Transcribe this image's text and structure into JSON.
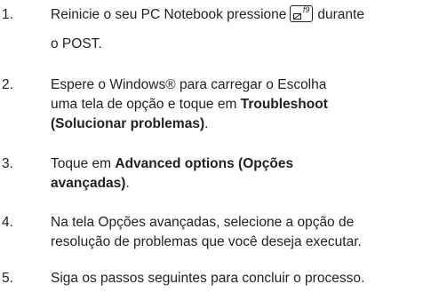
{
  "steps": [
    {
      "number": "1.",
      "pre": "Reinicie o seu PC Notebook pressione",
      "key_label": "f9",
      "post": "durante",
      "line2": "o POST."
    },
    {
      "number": "2.",
      "line1": "Espere o Windows® para carregar o Escolha",
      "line2_pre": "uma tela de opção e toque em ",
      "line2_bold": "Troubleshoot",
      "line3_bold": "(Solucionar problemas)",
      "line3_post": "."
    },
    {
      "number": "3.",
      "line1_pre": "Toque em ",
      "line1_bold": "Advanced options (Opções",
      "line2_bold": "avançadas)",
      "line2_post": "."
    },
    {
      "number": "4.",
      "line1": "Na tela Opções avançadas, selecione a opção de",
      "line2": "resolução de problemas que você deseja executar."
    },
    {
      "number": "5.",
      "line1": "Siga os passos seguintes para concluir o processo."
    }
  ]
}
